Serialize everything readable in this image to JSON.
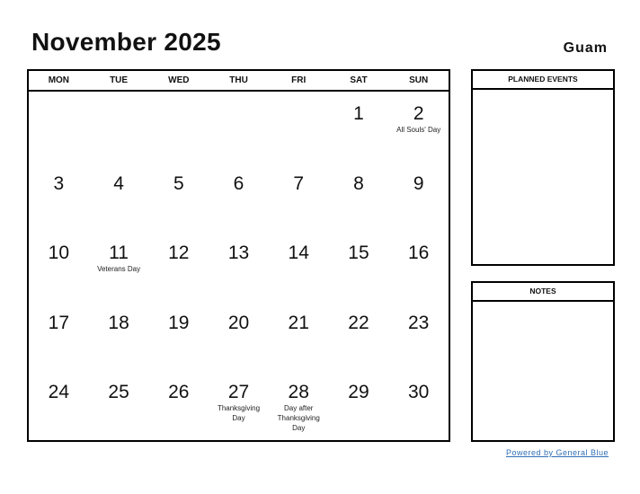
{
  "header": {
    "title": "November 2025",
    "region": "Guam"
  },
  "calendar": {
    "weekdays": [
      "MON",
      "TUE",
      "WED",
      "THU",
      "FRI",
      "SAT",
      "SUN"
    ],
    "weeks": [
      [
        {
          "day": ""
        },
        {
          "day": ""
        },
        {
          "day": ""
        },
        {
          "day": ""
        },
        {
          "day": ""
        },
        {
          "day": "1"
        },
        {
          "day": "2",
          "event": "All Souls' Day"
        }
      ],
      [
        {
          "day": "3"
        },
        {
          "day": "4"
        },
        {
          "day": "5"
        },
        {
          "day": "6"
        },
        {
          "day": "7"
        },
        {
          "day": "8"
        },
        {
          "day": "9"
        }
      ],
      [
        {
          "day": "10"
        },
        {
          "day": "11",
          "event": "Veterans Day"
        },
        {
          "day": "12"
        },
        {
          "day": "13"
        },
        {
          "day": "14"
        },
        {
          "day": "15"
        },
        {
          "day": "16"
        }
      ],
      [
        {
          "day": "17"
        },
        {
          "day": "18"
        },
        {
          "day": "19"
        },
        {
          "day": "20"
        },
        {
          "day": "21"
        },
        {
          "day": "22"
        },
        {
          "day": "23"
        }
      ],
      [
        {
          "day": "24"
        },
        {
          "day": "25"
        },
        {
          "day": "26"
        },
        {
          "day": "27",
          "event": "Thanksgiving Day"
        },
        {
          "day": "28",
          "event": "Day after Thanksgiving Day"
        },
        {
          "day": "29"
        },
        {
          "day": "30"
        }
      ]
    ]
  },
  "sidebar": {
    "planned_events_label": "PLANNED EVENTS",
    "notes_label": "NOTES"
  },
  "footer": {
    "powered_by": "Powered by General Blue"
  },
  "colors": {
    "link": "#2f6fb5",
    "border": "#000000"
  }
}
